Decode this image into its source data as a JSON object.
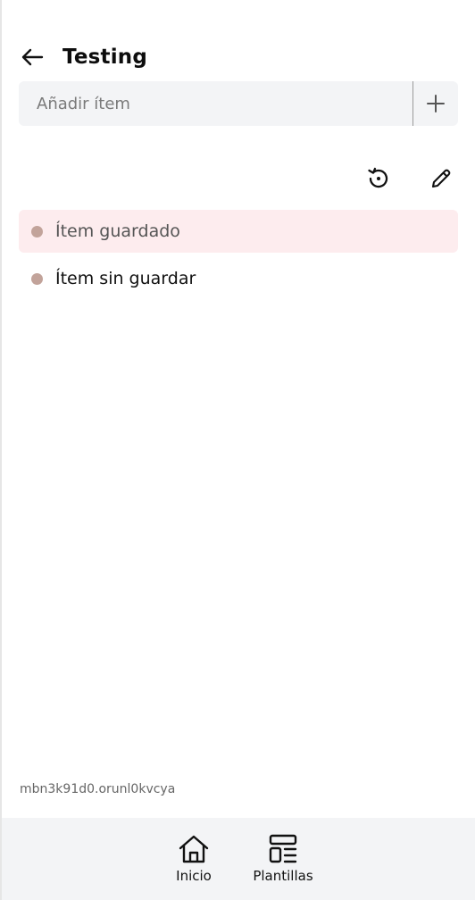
{
  "header": {
    "title": "Testing"
  },
  "add_item": {
    "placeholder": "Añadir ítem"
  },
  "list": {
    "items": [
      {
        "label": "Ítem guardado",
        "state": "saved"
      },
      {
        "label": "Ítem sin guardar",
        "state": "unsaved"
      }
    ]
  },
  "footer": {
    "session_id": "mbn3k91d0.orunl0kvcya"
  },
  "bottom_nav": {
    "items": [
      {
        "label": "Inicio",
        "icon": "home-icon"
      },
      {
        "label": "Plantillas",
        "icon": "templates-icon"
      }
    ]
  },
  "colors": {
    "saved_row_bg": "#fdecee",
    "dot": "#c2a39a",
    "input_bg": "#f3f4f6",
    "nav_bg": "#f3f4f6"
  }
}
